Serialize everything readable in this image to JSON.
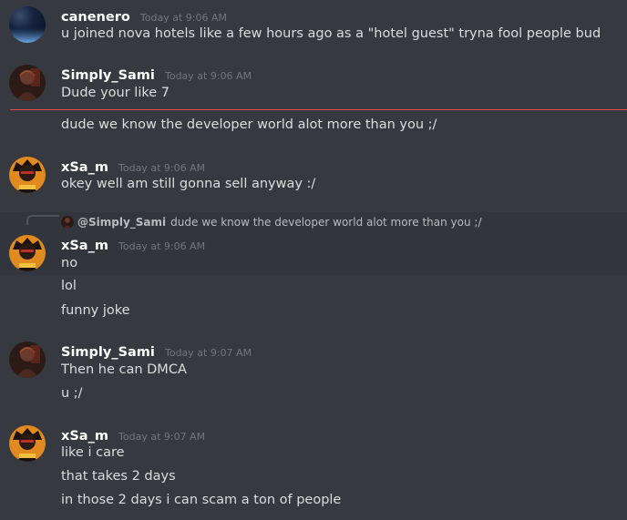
{
  "messages": [
    {
      "username": "canenero",
      "timestamp": "Today at 9:06 AM",
      "lines": [
        "u joined nova hotels like a few hours ago as a \"hotel guest\" tryna fool people bud"
      ]
    },
    {
      "username": "Simply_Sami",
      "timestamp": "Today at 9:06 AM",
      "lines": [
        "Dude your like 7",
        "dude we know the developer world alot more than you ;/"
      ]
    },
    {
      "username": "xSa_m",
      "timestamp": "Today at 9:06 AM",
      "lines": [
        "okey well am still gonna sell anyway :/"
      ]
    },
    {
      "reply": {
        "mention": "@Simply_Sami",
        "text": "dude we know the developer world alot more than you ;/"
      },
      "username": "xSa_m",
      "timestamp": "Today at 9:06 AM",
      "lines": [
        "no",
        "lol",
        "funny joke"
      ]
    },
    {
      "username": "Simply_Sami",
      "timestamp": "Today at 9:07 AM",
      "lines": [
        "Then he can DMCA",
        "u ;/"
      ]
    },
    {
      "username": "xSa_m",
      "timestamp": "Today at 9:07 AM",
      "lines": [
        "like i care",
        "that takes 2 days",
        "in those 2 days i can scam a ton of people"
      ]
    }
  ],
  "colors": {
    "background": "#36393f",
    "username": "#ffffff",
    "message_text": "#dcddde",
    "timestamp": "#72767d",
    "new_messages_divider": "#f04747"
  }
}
